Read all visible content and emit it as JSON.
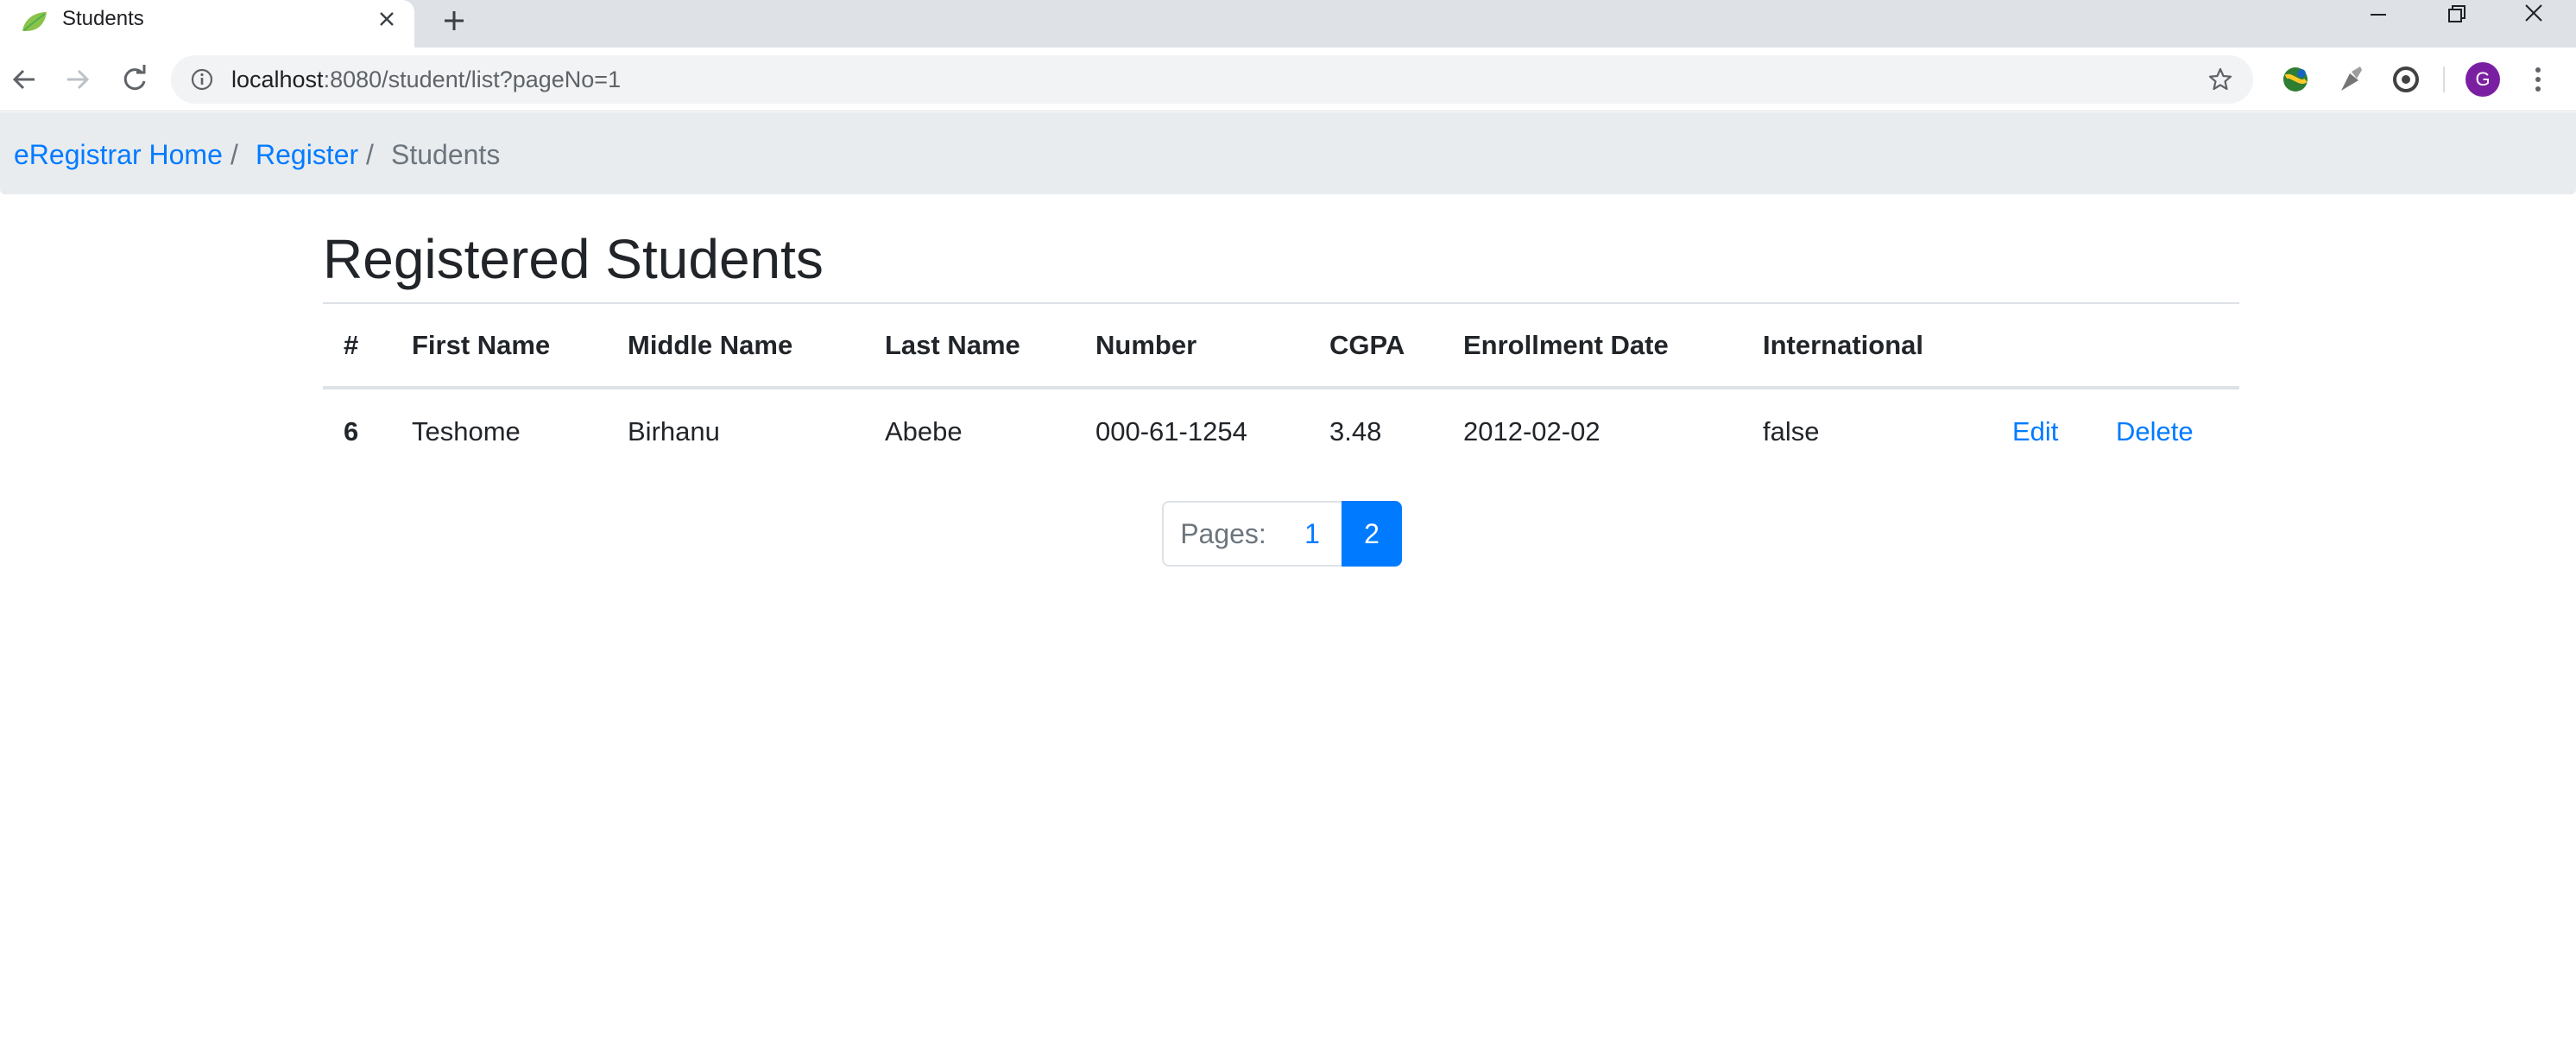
{
  "browser": {
    "tab_title": "Students",
    "url_host": "localhost",
    "url_rest": ":8080/student/list?pageNo=1",
    "avatar_letter": "G"
  },
  "breadcrumb": {
    "home": "eRegistrar Home",
    "sep1": "/",
    "register": "Register",
    "sep2": "/",
    "current": "Students"
  },
  "page": {
    "title": "Registered Students"
  },
  "table": {
    "headers": [
      "#",
      "First Name",
      "Middle Name",
      "Last Name",
      "Number",
      "CGPA",
      "Enrollment Date",
      "International"
    ],
    "rows": [
      {
        "id": "6",
        "first_name": "Teshome",
        "middle_name": "Birhanu",
        "last_name": "Abebe",
        "number": "000-61-1254",
        "cgpa": "3.48",
        "enrollment_date": "2012-02-02",
        "international": "false",
        "edit": "Edit",
        "delete": "Delete"
      }
    ]
  },
  "pagination": {
    "label": "Pages:",
    "pages": [
      "1",
      "2"
    ],
    "active_page": "2"
  },
  "colors": {
    "link": "#007bff",
    "breadcrumb_bg": "#e9ecef",
    "text": "#212529",
    "muted": "#6c757d"
  }
}
